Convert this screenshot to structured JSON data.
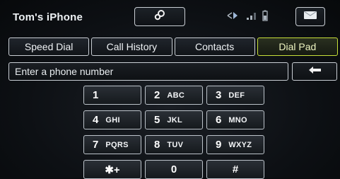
{
  "status_bar": {
    "device_name": "Tom's iPhone",
    "icons": [
      "link-icon",
      "bluetooth-icon",
      "signal-icon",
      "battery-icon",
      "message-icon"
    ]
  },
  "tabs": [
    {
      "label": "Speed Dial",
      "active": false
    },
    {
      "label": "Call History",
      "active": false
    },
    {
      "label": "Contacts",
      "active": false
    },
    {
      "label": "Dial Pad",
      "active": true
    }
  ],
  "entry": {
    "placeholder": "Enter a phone number",
    "backspace_icon": "backspace-arrow-icon"
  },
  "keypad": [
    {
      "digit": "1",
      "letters": ""
    },
    {
      "digit": "2",
      "letters": "ABC"
    },
    {
      "digit": "3",
      "letters": "DEF"
    },
    {
      "digit": "4",
      "letters": "GHI"
    },
    {
      "digit": "5",
      "letters": "JKL"
    },
    {
      "digit": "6",
      "letters": "MNO"
    },
    {
      "digit": "7",
      "letters": "PQRS"
    },
    {
      "digit": "8",
      "letters": "TUV"
    },
    {
      "digit": "9",
      "letters": "WXYZ"
    },
    {
      "digit": "✱+",
      "letters": ""
    },
    {
      "digit": "0",
      "letters": ""
    },
    {
      "digit": "#",
      "letters": ""
    }
  ],
  "colors": {
    "active_tab_border": "#c8e03a",
    "button_border": "#c9ced4",
    "background": "#0d1014"
  }
}
